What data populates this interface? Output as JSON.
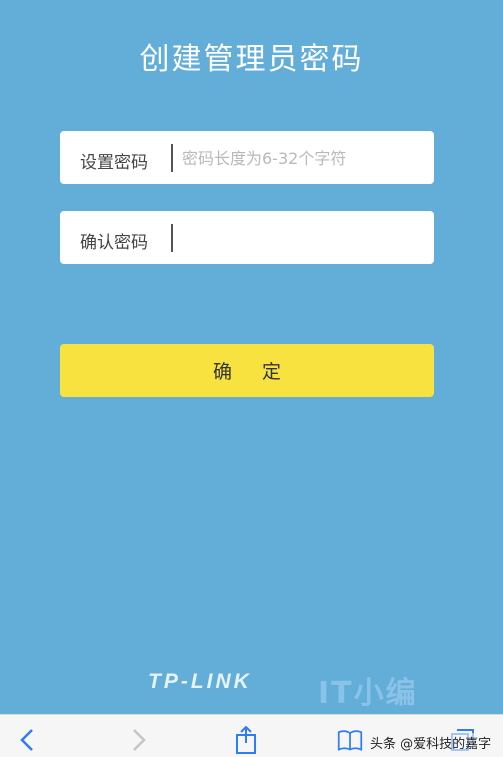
{
  "title": "创建管理员密码",
  "form": {
    "set_password_label": "设置密码",
    "set_password_placeholder": "密码长度为6-32个字符",
    "confirm_password_label": "确认密码",
    "confirm_password_placeholder": ""
  },
  "confirm_button_label": "确 定",
  "brand": "TP-LINK",
  "watermark_overlay": "IT小编",
  "watermark_credit": "头条 @爱科技的嘉字",
  "toolbar": {
    "icons": [
      "chevron-left-icon",
      "chevron-right-icon",
      "share-icon",
      "book-icon",
      "tabs-icon"
    ]
  },
  "colors": {
    "background": "#62aed9",
    "button": "#f7e23f",
    "field": "#ffffff"
  }
}
